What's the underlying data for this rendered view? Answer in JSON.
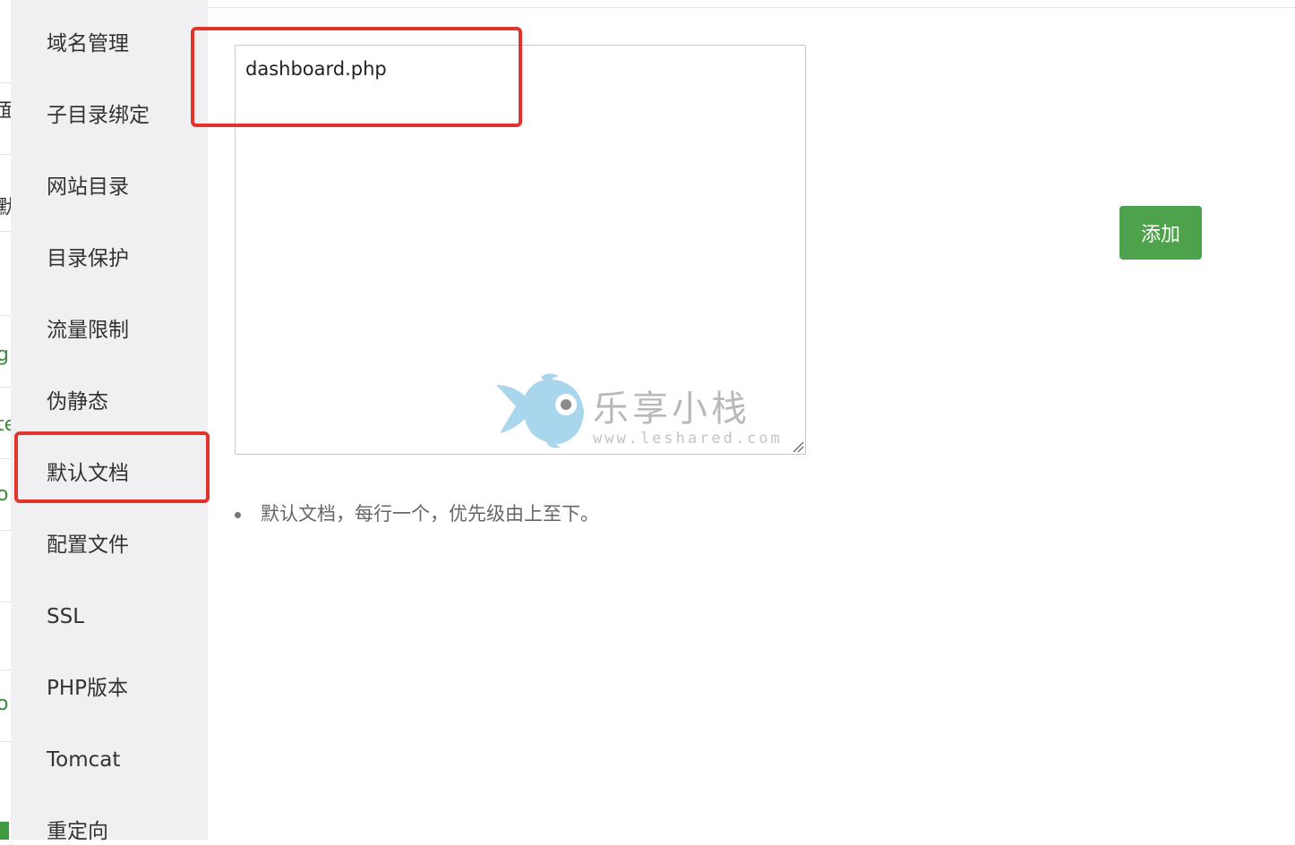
{
  "sidebar": {
    "items": [
      {
        "label": "域名管理"
      },
      {
        "label": "子目录绑定"
      },
      {
        "label": "网站目录"
      },
      {
        "label": "目录保护"
      },
      {
        "label": "流量限制"
      },
      {
        "label": "伪静态"
      },
      {
        "label": "默认文档",
        "active": true
      },
      {
        "label": "配置文件"
      },
      {
        "label": "SSL"
      },
      {
        "label": "PHP版本"
      },
      {
        "label": "Tomcat"
      },
      {
        "label": "重定向"
      }
    ]
  },
  "edge_fragments": [
    "面",
    "默",
    "g.",
    "te",
    "o",
    "o"
  ],
  "default_doc": {
    "value": "dashboard.php",
    "add_label": "添加",
    "hint": "默认文档，每行一个，优先级由上至下。"
  },
  "watermark": {
    "text": "乐享小栈",
    "url": "www.leshared.com"
  },
  "colors": {
    "accent_green": "#4ea24b",
    "highlight_red": "#e0342c",
    "sidebar_bg": "#f0f0f2"
  }
}
